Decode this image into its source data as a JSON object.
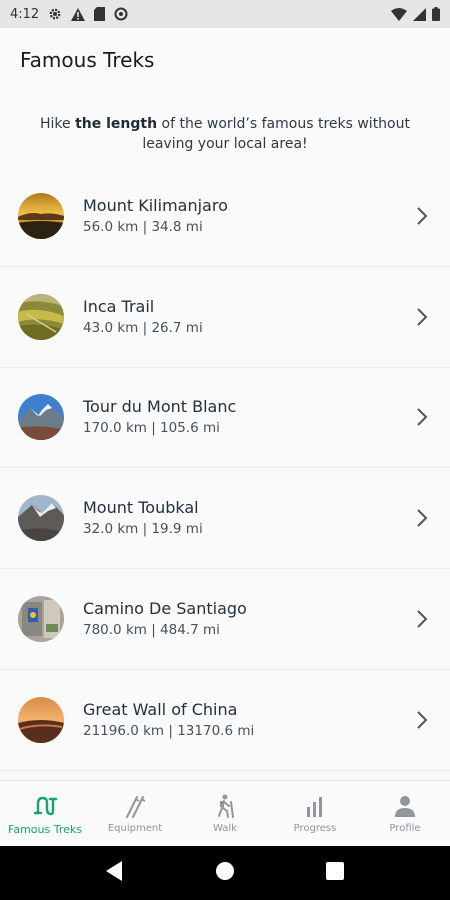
{
  "status_bar": {
    "time": "4:12",
    "icons_left": [
      "gear-icon",
      "warning-icon",
      "sd-card-icon",
      "at-sign-icon"
    ],
    "icons_right": [
      "wifi-icon",
      "signal-icon",
      "battery-icon"
    ]
  },
  "header": {
    "title": "Famous Treks"
  },
  "intro": {
    "prefix": "Hike ",
    "bold": "the length",
    "suffix": " of the world’s famous treks without leaving your local area!"
  },
  "treks": [
    {
      "name": "Mount Kilimanjaro",
      "distance": "56.0 km | 34.8 mi",
      "thumb_icon": "kilimanjaro-photo"
    },
    {
      "name": "Inca Trail",
      "distance": "43.0 km | 26.7 mi",
      "thumb_icon": "inca-trail-photo"
    },
    {
      "name": "Tour du Mont Blanc",
      "distance": "170.0 km | 105.6 mi",
      "thumb_icon": "mont-blanc-photo"
    },
    {
      "name": "Mount Toubkal",
      "distance": "32.0 km | 19.9 mi",
      "thumb_icon": "toubkal-photo"
    },
    {
      "name": "Camino De Santiago",
      "distance": "780.0 km | 484.7 mi",
      "thumb_icon": "camino-photo"
    },
    {
      "name": "Great Wall of China",
      "distance": "21196.0 km | 13170.6 mi",
      "thumb_icon": "great-wall-photo"
    }
  ],
  "bottom_nav": {
    "active": "Famous Treks",
    "accent_color": "#17a36b",
    "items": [
      {
        "label": "Famous Treks",
        "icon": "route-icon"
      },
      {
        "label": "Equipment",
        "icon": "hiking-poles-icon"
      },
      {
        "label": "Walk",
        "icon": "hiker-icon"
      },
      {
        "label": "Progress",
        "icon": "bar-chart-icon"
      },
      {
        "label": "Profile",
        "icon": "person-icon"
      }
    ]
  },
  "system_nav": {
    "buttons": [
      "back-icon",
      "home-icon",
      "recents-icon"
    ]
  }
}
